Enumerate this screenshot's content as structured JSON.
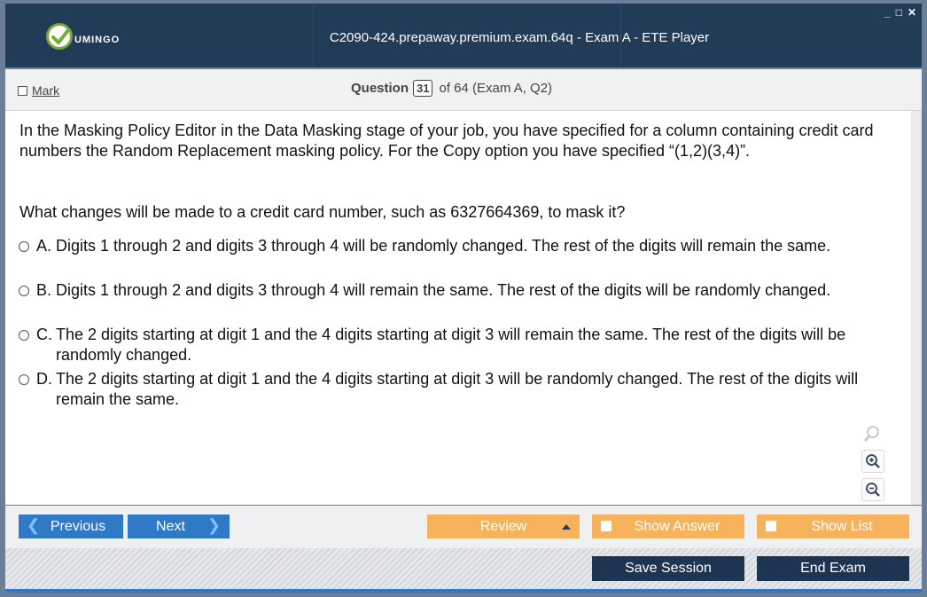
{
  "window": {
    "title": "C2090-424.prepaway.premium.exam.64q - Exam A - ETE Player",
    "controls": {
      "minimize": "_",
      "maximize": "□",
      "close": "✕"
    }
  },
  "brand": {
    "logo_text": "UMINGO",
    "accent": "#7aa83a"
  },
  "header": {
    "mark_label": "Mark",
    "question_label": "Question",
    "question_number": "31",
    "of_text": "of 64 (Exam A, Q2)"
  },
  "question": {
    "text": "In the Masking Policy Editor in the Data Masking stage of your job, you have specified for a column containing credit card numbers the Random Replacement masking policy. For the Copy option you have specified “(1,2)(3,4)”.",
    "prompt": "What changes will be made to a credit card number, such as 6327664369, to mask it?",
    "options": [
      {
        "letter": "A.",
        "text": "Digits 1 through 2 and digits 3 through 4 will be randomly changed. The rest of the digits will remain the same."
      },
      {
        "letter": "B.",
        "text": "Digits 1 through 2 and digits 3 through 4 will remain the same. The rest of the digits will be randomly changed."
      },
      {
        "letter": "C.",
        "text": "The 2 digits starting at digit 1 and the 4 digits starting at digit 3 will remain the same. The rest of the digits will be randomly changed."
      },
      {
        "letter": "D.",
        "text": "The 2 digits starting at digit 1 and the 4 digits starting at digit 3 will be randomly changed. The rest of the digits will remain the same."
      }
    ]
  },
  "zoom": {
    "icons": [
      "search-icon",
      "zoom-in-icon",
      "zoom-out-icon"
    ]
  },
  "nav": {
    "previous": "Previous",
    "next": "Next",
    "review": "Review",
    "show_answer": "Show Answer",
    "show_list": "Show List",
    "save_session": "Save Session",
    "end_exam": "End Exam"
  },
  "colors": {
    "title_bar": "#223b56",
    "primary_button": "#2f79c7",
    "secondary_button": "#f7b25c",
    "dark_button": "#1e3552"
  }
}
